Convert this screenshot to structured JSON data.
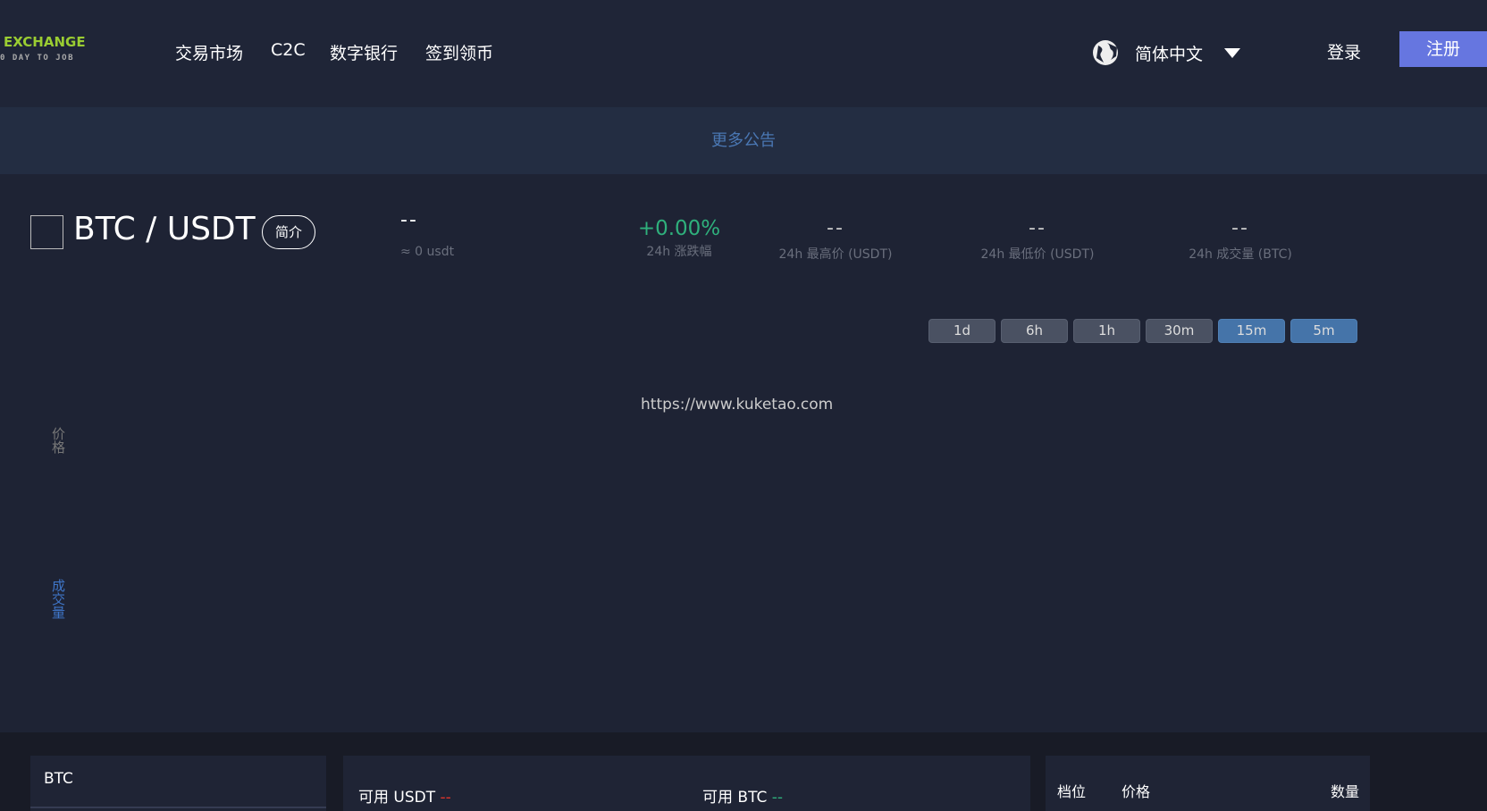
{
  "header": {
    "logo_title": "EXCHANGE",
    "logo_sub": "0 DAY TO JOB",
    "nav": [
      "交易市场",
      "C2C",
      "数字银行",
      "签到领币"
    ],
    "language": "简体中文",
    "login": "登录",
    "register": "注册"
  },
  "notice": {
    "more": "更多公告"
  },
  "ticker": {
    "pair": "BTC / USDT",
    "intro": "简介",
    "price": "--",
    "approx": "≈ 0 usdt",
    "stats": [
      {
        "value": "+0.00%",
        "label": "24h 涨跌幅"
      },
      {
        "value": "--",
        "label": "24h 最高价 (USDT)"
      },
      {
        "value": "--",
        "label": "24h 最低价 (USDT)"
      },
      {
        "value": "--",
        "label": "24h 成交量 (BTC)"
      }
    ]
  },
  "chart": {
    "intervals": [
      "1d",
      "6h",
      "1h",
      "30m",
      "15m",
      "5m"
    ],
    "active": [
      "15m",
      "5m"
    ],
    "watermark": "https://www.kuketao.com",
    "price_label": "价格",
    "volume_label": "成交量"
  },
  "bottom": {
    "coin_tab": "BTC",
    "avail_usdt": "可用 USDT",
    "avail_usdt_val": "--",
    "avail_btc": "可用 BTC",
    "avail_btc_val": "--",
    "book_cols": [
      "档位",
      "价格",
      "数量"
    ]
  }
}
